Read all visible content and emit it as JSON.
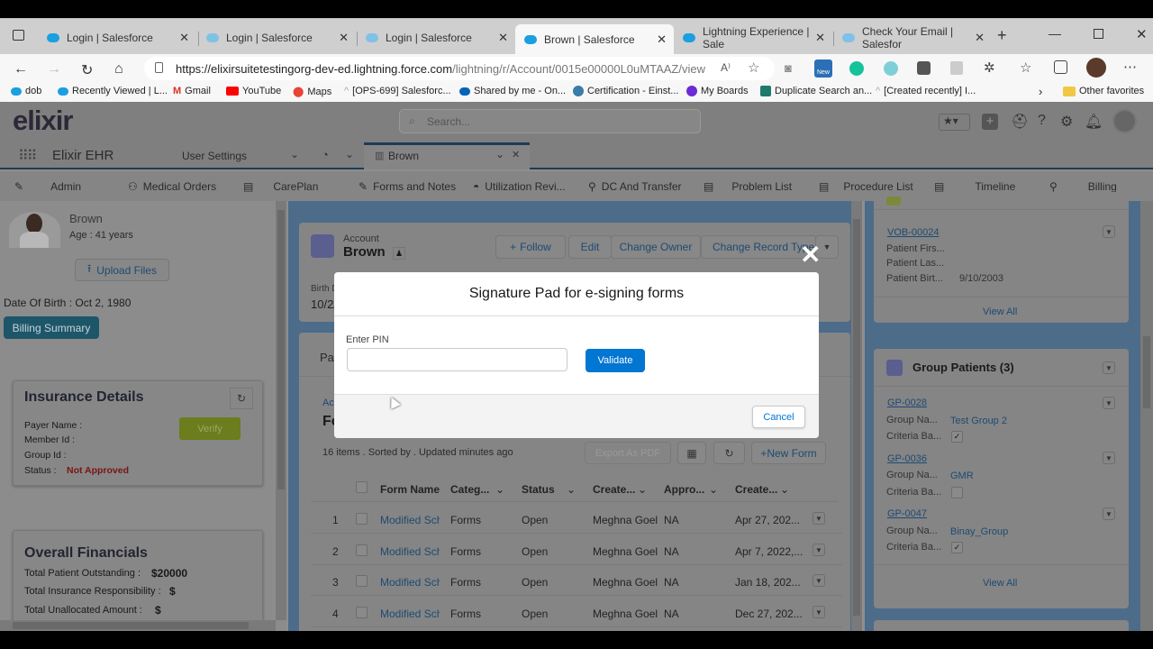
{
  "browser": {
    "tabs": [
      {
        "label": "Login | Salesforce",
        "active": false
      },
      {
        "label": "Login | Salesforce",
        "active": false
      },
      {
        "label": "Login | Salesforce",
        "active": false
      },
      {
        "label": "Brown | Salesforce",
        "active": true
      },
      {
        "label": "Lightning Experience | Sale",
        "active": false
      },
      {
        "label": "Check Your Email | Salesfor",
        "active": false
      }
    ],
    "url_domain": "https://elixirsuitetestingorg-dev-ed.lightning.force.com",
    "url_path": "/lightning/r/Account/0015e00000L0uMTAAZ/view",
    "new_badge": "New",
    "bookmarks": [
      "dob",
      "Recently Viewed | L...",
      "Gmail",
      "YouTube",
      "Maps",
      "[OPS-699] Salesforc...",
      "Shared by me - On...",
      "Certification - Einst...",
      "My Boards",
      "Duplicate Search an...",
      "[Created recently] I..."
    ],
    "other_favorites": "Other favorites"
  },
  "app": {
    "logo": "elixir",
    "search_placeholder": "Search...",
    "app_name": "Elixir EHR",
    "nav_select": "User Settings",
    "record_tab": "Brown",
    "subnav": [
      "Admin",
      "Medical Orders",
      "CarePlan",
      "Forms and Notes",
      "Utilization Revi...",
      "DC And Transfer",
      "Problem List",
      "Procedure List",
      "Timeline",
      "Billing"
    ]
  },
  "patient": {
    "name": "Brown",
    "age": "Age : 41 years",
    "upload": "Upload Files",
    "dob": "Date Of Birth : Oct 2, 1980",
    "billing_summary": "Billing Summary"
  },
  "insurance": {
    "title": "Insurance Details",
    "payer": "Payer Name  :",
    "member": "Member Id  :",
    "group": "Group Id  :",
    "status_label": "Status  :",
    "status_value": "Not Approved",
    "verify": "Verify"
  },
  "financials": {
    "title": "Overall Financials",
    "outstanding_label": "Total Patient Outstanding  :",
    "outstanding_value": "$20000",
    "insurance_label": "Total Insurance Responsibility  :",
    "insurance_value": "$",
    "unallocated_label": "Total Unallocated Amount  :",
    "unallocated_value": "$"
  },
  "account": {
    "object": "Account",
    "name": "Brown",
    "follow": "Follow",
    "edit": "Edit",
    "change_owner": "Change Owner",
    "change_record_type": "Change Record Type",
    "birth_label": "Birth D",
    "birth_value": "10/2/"
  },
  "forms": {
    "tab_partial": "Pat",
    "header_partial_small": "Ac",
    "header_partial_big": "Fo",
    "summary": "16 items . Sorted by . Updated minutes ago",
    "export": "Export As PDF",
    "new_form": "+New Form",
    "columns": [
      "Form Name",
      "Categ...",
      "Status",
      "Create...",
      "Appro...",
      "Create..."
    ],
    "rows": [
      {
        "num": "1",
        "name": "Modified Sch",
        "category": "Forms",
        "status": "Open",
        "created_by": "Meghna Goel",
        "approval": "NA",
        "created": "Apr 27, 202..."
      },
      {
        "num": "2",
        "name": "Modified Sch",
        "category": "Forms",
        "status": "Open",
        "created_by": "Meghna Goel",
        "approval": "NA",
        "created": "Apr 7, 2022,..."
      },
      {
        "num": "3",
        "name": "Modified Sch",
        "category": "Forms",
        "status": "Open",
        "created_by": "Meghna Goel",
        "approval": "NA",
        "created": "Jan 18, 202..."
      },
      {
        "num": "4",
        "name": "Modified Sch",
        "category": "Forms",
        "status": "Open",
        "created_by": "Meghna Goel",
        "approval": "NA",
        "created": "Dec 27, 202..."
      }
    ]
  },
  "vob": {
    "id": "VOB-00024",
    "first": "Patient Firs...",
    "last": "Patient Las...",
    "birth_label": "Patient Birt...",
    "birth_value": "9/10/2003",
    "view_all": "View All"
  },
  "group_patients": {
    "title": "Group Patients (3)",
    "items": [
      {
        "id": "GP-0028",
        "name_label": "Group Na...",
        "name": "Test Group 2",
        "criteria_label": "Criteria Ba...",
        "checked": true
      },
      {
        "id": "GP-0036",
        "name_label": "Group Na...",
        "name": "GMR",
        "criteria_label": "Criteria Ba...",
        "checked": false
      },
      {
        "id": "GP-0047",
        "name_label": "Group Na...",
        "name": "Binay_Group",
        "criteria_label": "Criteria Ba...",
        "checked": true
      }
    ],
    "view_all": "View All"
  },
  "modal": {
    "title": "Signature Pad for e-signing forms",
    "pin_label": "Enter PIN",
    "pin_value": "",
    "validate": "Validate",
    "cancel": "Cancel"
  },
  "colors": {
    "brand": "#0176d3",
    "danger": "#c23934",
    "verify": "#6b8c1e",
    "billing": "#1f6f8b"
  }
}
